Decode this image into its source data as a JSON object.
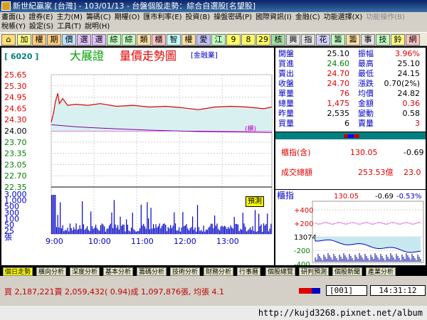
{
  "window": {
    "title": "新世紀贏家 [台灣] - 103/01/13 - 台盤個股走勢：綜合自選股[名望股]"
  },
  "menu": {
    "row1": [
      "畫面(L)",
      "證券(E)",
      "主力(M)",
      "籌碼(C)",
      "期權(O)",
      "匯市利率(E)",
      "投資(B)",
      "操盤密碼(P)",
      "國際資訊(I)",
      "金融(C)",
      "功能選擇(X)"
    ],
    "row1_dim": "功能操作(B)",
    "row2": [
      "稅帳(Y)",
      "設定(S)",
      "工具(T)",
      "說明(H)"
    ]
  },
  "toolbar": {
    "buttons": [
      "加",
      "權",
      "期",
      "價",
      "選",
      "選",
      "綜",
      "綜",
      "類",
      "櫃",
      "智",
      "權",
      "愛",
      "江",
      "9",
      "8",
      "29",
      "核",
      "興",
      "指",
      "花",
      "籌",
      "籌",
      "事",
      "技",
      "鈴",
      "網"
    ]
  },
  "chart": {
    "code": "[ 6020 ]",
    "name": "大展證",
    "title": "量價走勢圖",
    "tag": "[金融業]",
    "side_label": "(櫃)",
    "signal": "預測"
  },
  "chart_data": [
    {
      "type": "line",
      "title": "量價走勢圖",
      "x": [
        "9:00",
        "10:00",
        "11:00",
        "12:00",
        "13:00"
      ],
      "yticks": [
        "25.65",
        "25.30",
        "24.95",
        "24.65",
        "24.30",
        "24.00",
        "23.70",
        "23.35",
        "23.05",
        "22.70",
        "22.35"
      ],
      "ylim": [
        22.35,
        25.65
      ],
      "ref_price": 24.0,
      "series": [
        {
          "name": "price",
          "values": [
            [
              0,
              24.25
            ],
            [
              3,
              24.55
            ],
            [
              5,
              24.85
            ],
            [
              8,
              25.1
            ],
            [
              10,
              24.8
            ],
            [
              14,
              24.95
            ],
            [
              20,
              24.75
            ],
            [
              30,
              24.78
            ],
            [
              45,
              24.75
            ],
            [
              60,
              24.8
            ],
            [
              80,
              24.72
            ],
            [
              100,
              24.75
            ],
            [
              120,
              24.7
            ],
            [
              140,
              24.72
            ],
            [
              160,
              24.68
            ],
            [
              180,
              24.62
            ],
            [
              200,
              24.7
            ],
            [
              220,
              24.72
            ],
            [
              240,
              24.7
            ],
            [
              260,
              24.65
            ],
            [
              270,
              24.7
            ]
          ]
        },
        {
          "name": "average",
          "values": [
            [
              0,
              24.18
            ],
            [
              30,
              24.12
            ],
            [
              60,
              24.08
            ],
            [
              90,
              24.05
            ],
            [
              120,
              24.02
            ],
            [
              150,
              24.0
            ],
            [
              180,
              23.98
            ],
            [
              210,
              23.97
            ],
            [
              240,
              23.96
            ],
            [
              270,
              23.95
            ]
          ]
        }
      ]
    },
    {
      "type": "bar",
      "title": "volume",
      "yticks": [
        "3,000",
        "1,000",
        "500",
        "300",
        "100",
        "50",
        "25",
        "張"
      ],
      "ylim": [
        0,
        3000
      ]
    }
  ],
  "quote": {
    "rows": [
      {
        "l1": "開盤",
        "v1": "25.10",
        "c1": "bk",
        "l2": "振幅",
        "v2": "3.96%",
        "c2": "rd"
      },
      {
        "l1": "買進",
        "v1": "24.60",
        "c1": "gr",
        "l2": "最高",
        "v2": "25.10",
        "c2": "bk"
      },
      {
        "l1": "賣出",
        "v1": "24.70",
        "c1": "rd",
        "l2": "最低",
        "v2": "24.15",
        "c2": "bk"
      },
      {
        "l1": "收盤",
        "v1": "24.70",
        "c1": "rd",
        "l2": "漲跌",
        "v2": "0.70(2%)",
        "c2": "bk"
      },
      {
        "l1": "單量",
        "v1": "76",
        "c1": "rd",
        "l2": "均價",
        "v2": "24.82",
        "c2": "bk"
      },
      {
        "l1": "總量",
        "v1": "1,475",
        "c1": "rd",
        "l2": "金額",
        "v2": "0.36",
        "c2": "rd"
      },
      {
        "l1": "昨量",
        "v1": "2,535",
        "c1": "bk",
        "l2": "變動",
        "v2": "0.58",
        "c2": "bk"
      },
      {
        "l1": "買量",
        "v1": "6",
        "c1": "bk",
        "l2": "賣量",
        "v2": "3",
        "c2": "rd"
      }
    ],
    "index_label": "櫃指(含)",
    "index_value": "130.05",
    "index_change": "-0.69",
    "turnover_label": "成交總額",
    "turnover_value": "253.53億",
    "turnover_extra": "23.0"
  },
  "index_chart": {
    "label": "櫃指",
    "value": "130.05",
    "change": "-0.69",
    "pct": "-0.53%",
    "ticks": [
      "+400",
      "+200",
      "13074",
      "-200",
      "-400"
    ]
  },
  "tabs": [
    "個日走勢",
    "橫向分析",
    "深度分析",
    "基本分析",
    "籌碼分析",
    "技術分析",
    "財務分析",
    "行事曆",
    "個股總覽",
    "研判預測",
    "個股新聞",
    "產業分析"
  ],
  "status": {
    "text": "買 2,187,221賣 2,059,432( 0.94)成 1,097,876張, 均張 4.1",
    "code": "001",
    "time": "14:31:12"
  },
  "footer": {
    "url": "http://kujd3268.pixnet.net/album"
  }
}
